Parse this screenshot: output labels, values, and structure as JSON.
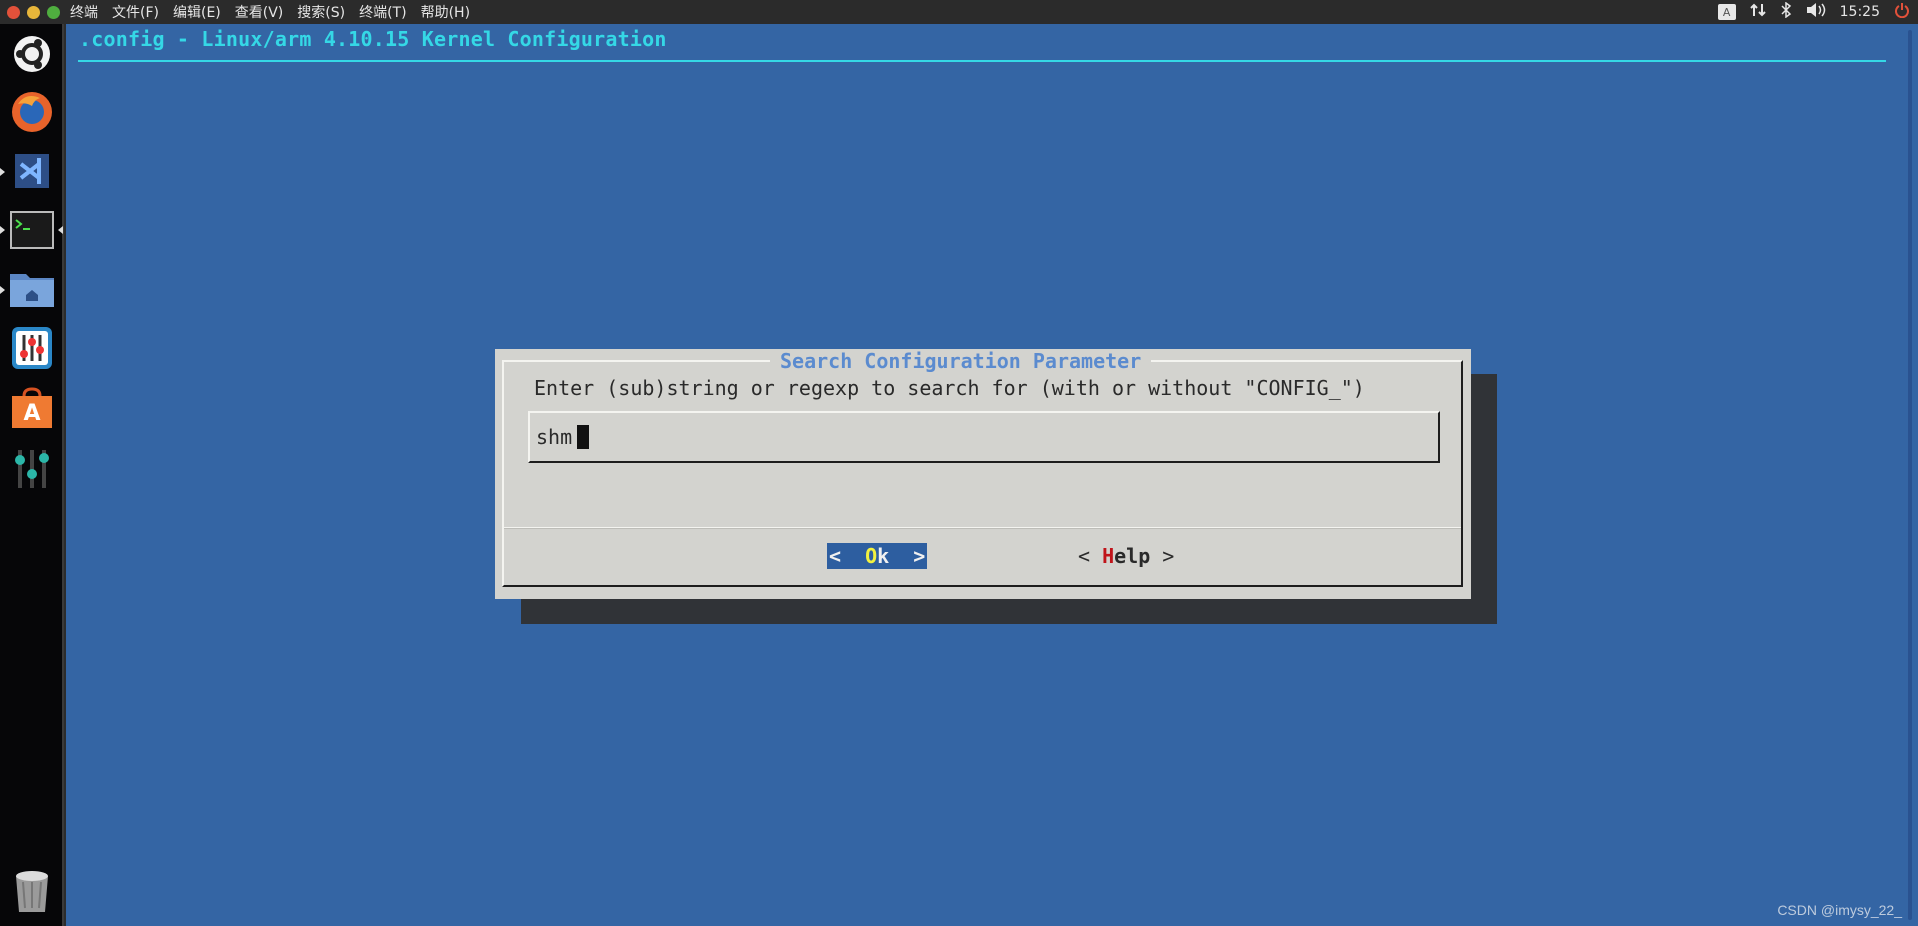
{
  "topbar": {
    "menu": [
      "终端",
      "文件(F)",
      "编辑(E)",
      "查看(V)",
      "搜索(S)",
      "终端(T)",
      "帮助(H)"
    ],
    "tray": {
      "keyboard": "A",
      "time": "15:25",
      "icons": [
        "keyboard-indicator-icon",
        "network-icon",
        "bluetooth-icon",
        "volume-icon",
        "power-icon"
      ]
    },
    "window_buttons": {
      "close": "#e2513a",
      "minimize": "#e8b63a",
      "maximize": "#4fae3f"
    }
  },
  "launcher": {
    "items": [
      "ubuntu-dash-icon",
      "firefox-icon",
      "vscode-icon",
      "terminal-icon",
      "files-home-icon",
      "settings-sliders-icon",
      "software-center-icon",
      "mixer-icon",
      "trash-icon"
    ]
  },
  "terminal": {
    "title": ".config - Linux/arm 4.10.15 Kernel Configuration",
    "background": "#3465a4",
    "title_color": "#35d8e6"
  },
  "dialog": {
    "title": "Search Configuration Parameter",
    "prompt": "Enter (sub)string or regexp to search for (with or without \"CONFIG_\")",
    "input_value": "shm",
    "ok": {
      "open": "<  ",
      "hotkey": "O",
      "rest": "k  >"
    },
    "help": {
      "open": "< ",
      "hotkey": "H",
      "rest": "elp",
      "close": " >"
    }
  },
  "watermark": "CSDN @imysy_22_"
}
